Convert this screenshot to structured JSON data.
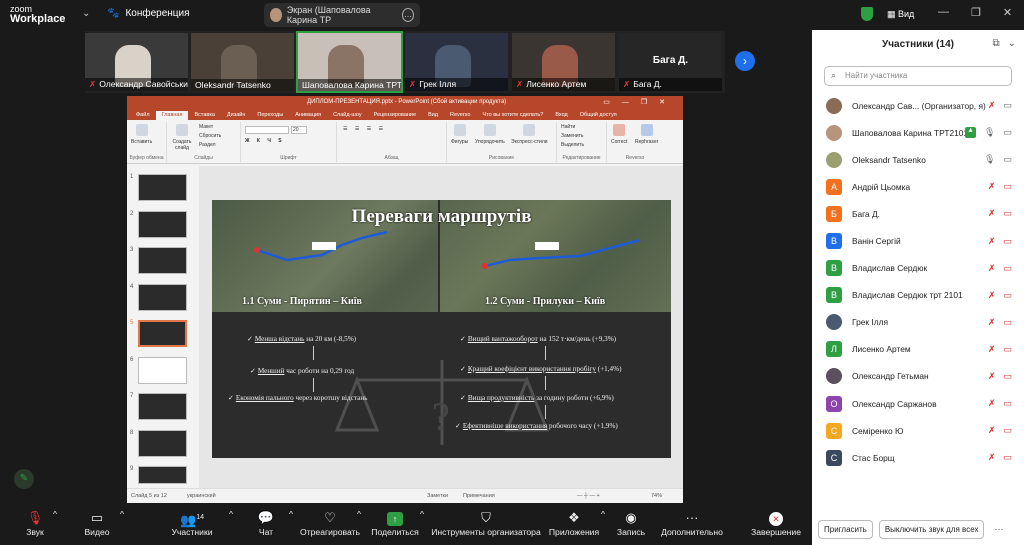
{
  "app": {
    "brand_top": "zoom",
    "brand_bottom": "Workplace",
    "meeting_label": "Конференция",
    "share_label": "Экран (Шаповалова Карина ТР",
    "view_label": "Вид"
  },
  "strip": {
    "tiles": [
      "Олександр Савойськи...",
      "Oleksandr Tatsenko",
      "Шаповалова Карина ТРТ...",
      "Грек Ілля",
      "Лисенко Артем",
      "Бага Д."
    ],
    "big_name": "Бага Д."
  },
  "ppt": {
    "title": "ДИПЛОМ-ПРЕЗЕНТАЦИЯ.pptx - PowerPoint (Сбой активации продукта)",
    "menu": [
      "Файл",
      "Главная",
      "Вставка",
      "Дизайн",
      "Переходы",
      "Анимация",
      "Слайд-шоу",
      "Рецензирование",
      "Вид",
      "Reverso",
      "Что вы хотите сделать?",
      "Вход",
      "Общий доступ"
    ],
    "ribbon": {
      "groups": [
        "Буфер обмена",
        "Слайды",
        "Шрифт",
        "Абзац",
        "Рисование",
        "Редактирование",
        "Reverso"
      ],
      "buttons": [
        "Вставить",
        "Создать слайд",
        "Макет",
        "Сбросить",
        "Раздел",
        "Фигуры",
        "Упорядочить",
        "Экспресс-стили",
        "Найти",
        "Заменить",
        "Выделить",
        "Correct",
        "Rephraser"
      ],
      "font_size": "20"
    },
    "thumb_numbers": [
      "1",
      "2",
      "3",
      "4",
      "5",
      "6",
      "7",
      "8",
      "9"
    ],
    "slide": {
      "title": "Переваги маршрутів",
      "left_sub": "1.1 Суми - Пирятин – Київ",
      "right_sub": "1.2 Суми - Прилуки – Київ",
      "left_bullets": [
        {
          "u": "Менша відстань",
          "t": " на 20 км (-8,5%)"
        },
        {
          "u": "Менший",
          "t": " час роботи на 0,29 год"
        },
        {
          "u": "Економія пального",
          "t": " через коротшу відстань"
        }
      ],
      "right_bullets": [
        {
          "u": "Вищий вантажооборот",
          "t": " на 152 т·км/день (+9,3%)"
        },
        {
          "u": "Кращий коефіцієнт використання пробігу",
          "t": " (+1,4%)"
        },
        {
          "u": "Вища продуктивність",
          "t": " за годину роботи (+6,9%)"
        },
        {
          "u": "Ефективніше використання",
          "t": " робочого часу (+1,9%)"
        }
      ]
    },
    "status": {
      "slide_info": "Слайд 5 из 12",
      "lang": "украинский",
      "notes": "Заметки",
      "comments": "Примечания",
      "zoom": "74%"
    }
  },
  "participants": {
    "title": "Участники (14)",
    "search_placeholder": "Найти участника",
    "list": [
      {
        "name": "Олександр Сав... (Организатор, я)",
        "initial": "",
        "color": "#8a6b55"
      },
      {
        "name": "Шаповалова Карина ТРТ2101",
        "initial": "",
        "color": "#b7957c"
      },
      {
        "name": "Oleksandr Tatsenko",
        "initial": "",
        "color": "#9aa070"
      },
      {
        "name": "Андрій Цьомка",
        "initial": "А",
        "color": "#f37021"
      },
      {
        "name": "Бага Д.",
        "initial": "Б",
        "color": "#f37021"
      },
      {
        "name": "Ванін Сергій",
        "initial": "В",
        "color": "#1f6feb"
      },
      {
        "name": "Владислав Сердюк",
        "initial": "В",
        "color": "#2ea043"
      },
      {
        "name": "Владислав Сердюк трт 2101",
        "initial": "В",
        "color": "#2ea043"
      },
      {
        "name": "Грек Ілля",
        "initial": "",
        "color": "#4a5a70"
      },
      {
        "name": "Лисенко Артем",
        "initial": "Л",
        "color": "#2ea043"
      },
      {
        "name": "Олександр Гетьман",
        "initial": "",
        "color": "#5a5060"
      },
      {
        "name": "Олександр Саржанов",
        "initial": "О",
        "color": "#8e44ad"
      },
      {
        "name": "Семіренко Ю",
        "initial": "С",
        "color": "#f5a623"
      },
      {
        "name": "Стас Борщ",
        "initial": "С",
        "color": "#3a4a5c"
      }
    ],
    "invite_label": "Пригласить",
    "mute_all_label": "Выключить звук для всех"
  },
  "toolbar": {
    "items": [
      "Звук",
      "Видео",
      "Участники",
      "Чат",
      "Отреагировать",
      "Поделиться",
      "Инструменты организатора",
      "Приложения",
      "Запись",
      "Дополнительно",
      "Завершение"
    ],
    "participants_count": "14"
  }
}
